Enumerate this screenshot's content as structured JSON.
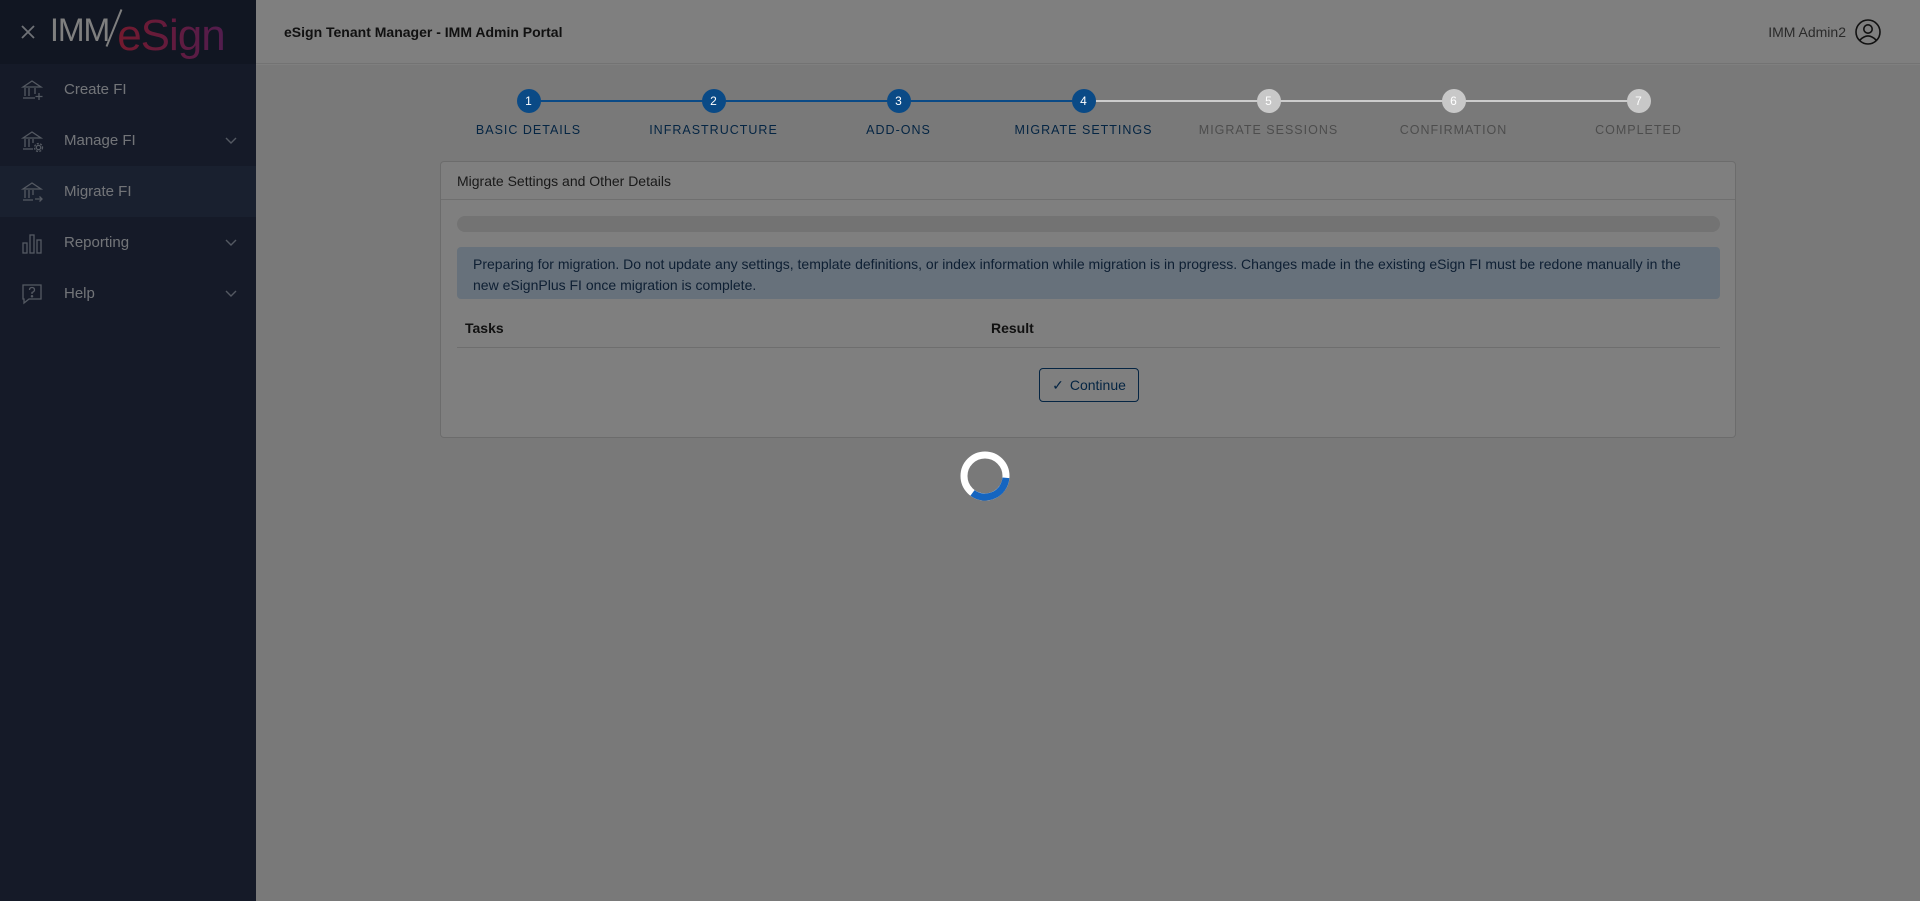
{
  "sidebar": {
    "logo": {
      "imm": "IMM",
      "esign": "eSign"
    },
    "items": [
      {
        "label": "Create FI",
        "icon": "bank-add-icon",
        "has_chevron": false,
        "active": false
      },
      {
        "label": "Manage FI",
        "icon": "bank-settings-icon",
        "has_chevron": true,
        "active": false
      },
      {
        "label": "Migrate FI",
        "icon": "bank-migrate-icon",
        "has_chevron": false,
        "active": true
      },
      {
        "label": "Reporting",
        "icon": "bar-chart-icon",
        "has_chevron": true,
        "active": false
      },
      {
        "label": "Help",
        "icon": "help-icon",
        "has_chevron": true,
        "active": false
      }
    ]
  },
  "header": {
    "title": "eSign Tenant Manager - IMM Admin Portal",
    "user_name": "IMM Admin2"
  },
  "stepper": {
    "steps": [
      {
        "number": "1",
        "label": "BASIC DETAILS",
        "state": "done"
      },
      {
        "number": "2",
        "label": "INFRASTRUCTURE",
        "state": "done"
      },
      {
        "number": "3",
        "label": "ADD-ONS",
        "state": "done"
      },
      {
        "number": "4",
        "label": "MIGRATE SETTINGS",
        "state": "done"
      },
      {
        "number": "5",
        "label": "MIGRATE SESSIONS",
        "state": "todo"
      },
      {
        "number": "6",
        "label": "CONFIRMATION",
        "state": "todo"
      },
      {
        "number": "7",
        "label": "COMPLETED",
        "state": "todo"
      }
    ]
  },
  "card": {
    "title": "Migrate Settings and Other Details",
    "progress": 0,
    "alert_text": "Preparing for migration. Do not update any settings, template definitions, or index information while migration is in progress. Changes made in the existing eSign FI must be redone manually in the new eSignPlus FI once migration is complete.",
    "table": {
      "col_tasks": "Tasks",
      "col_result": "Result"
    },
    "continue_label": "Continue"
  },
  "colors": {
    "primary": "#0a4a86",
    "sidebar_bg": "#2a3550",
    "alert_bg": "#cfe3f6",
    "spinner_accent": "#1565c0"
  }
}
